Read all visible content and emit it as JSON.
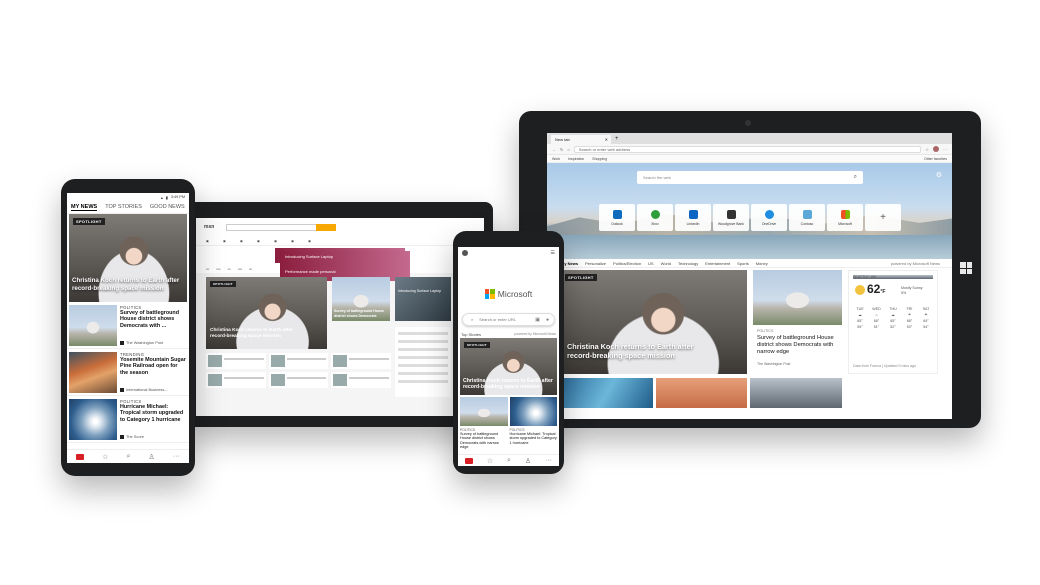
{
  "big_tablet": {
    "tab_title": "New tab",
    "address_placeholder": "Search or enter web address",
    "favorites": [
      "Work",
      "Inspiration",
      "Shopping"
    ],
    "other_favorites": "Other favorites",
    "search_placeholder": "Search the web",
    "quick_links": [
      "Outlook",
      "Xbox",
      "LinkedIn",
      "Woodgrove Bank",
      "OneDrive",
      "Contoso",
      "Microsoft"
    ],
    "news_tabs": [
      "My News",
      "Personalize",
      "Politics/Election",
      "US",
      "World",
      "Technology",
      "Entertainment",
      "Sports",
      "Money"
    ],
    "powered_by": "powered by Microsoft News",
    "spotlight": "SPOTLIGHT",
    "hero_headline": "Christina Koch returns to Earth after record-breaking space mission",
    "politics_label": "POLITICS",
    "politics_headline": "Survey of battleground House district shows Democrats with narrow edge",
    "politics_source": "The Washington Post",
    "weather": {
      "city": "SEATTLE, WA",
      "temp": "62",
      "unit": "°F",
      "condition": "Mostly Sunny",
      "precip": "5%",
      "days": [
        "TUE",
        "WED",
        "THU",
        "FRI",
        "SAT"
      ],
      "highs": [
        "65°",
        "66°",
        "65°",
        "68°",
        "64°"
      ],
      "lows": [
        "55°",
        "51°",
        "52°",
        "53°",
        "54°"
      ],
      "footer": "Data from Foreca | Updated 9 mins ago"
    }
  },
  "left_tablet": {
    "logo": "msn",
    "ad_text": "Introducing Surface Laptop",
    "ad_sub": "Performance made personal",
    "hero_headline": "Christina Koch returns to Earth after record-breaking space mission",
    "side_headline": "Survey of battleground House district shows Democrats",
    "surface_text": "Introducing Surface Laptop",
    "spotlight": "SPOTLIGHT"
  },
  "left_phone": {
    "status": "3:49 PM",
    "tabs": [
      "MY NEWS",
      "TOP STORIES",
      "GOOD NEWS"
    ],
    "spotlight": "SPOTLIGHT",
    "hero_headline": "Christina Koch returns to Earth after record-breaking space mission",
    "items": [
      {
        "cat": "POLITICS",
        "headline": "Survey of battleground House district shows Democrats with ...",
        "source": "The Washington Post"
      },
      {
        "cat": "TRENDING",
        "headline": "Yosemite Mountain Sugar Pine Railroad open for the season",
        "source": "International Business..."
      },
      {
        "cat": "POLITICS",
        "headline": "Hurricane Michael: Tropical storm upgraded to Category 1 hurricane",
        "source": "The Score"
      }
    ]
  },
  "mid_phone": {
    "brand": "Microsoft",
    "search_placeholder": "Search or enter URL",
    "top_stories": "Top Stories",
    "powered_by": "powered by Microsoft News",
    "spotlight": "SPOTLIGHT",
    "hero_headline": "Christina Koch returns to Earth after record-breaking space mission",
    "cards": [
      {
        "cat": "POLITICS",
        "headline": "Survey of battleground House district shows Democrats with narrow edge"
      },
      {
        "cat": "POLITICS",
        "headline": "Hurricane Michael: Tropical storm upgraded to Category 1 hurricane"
      }
    ]
  }
}
